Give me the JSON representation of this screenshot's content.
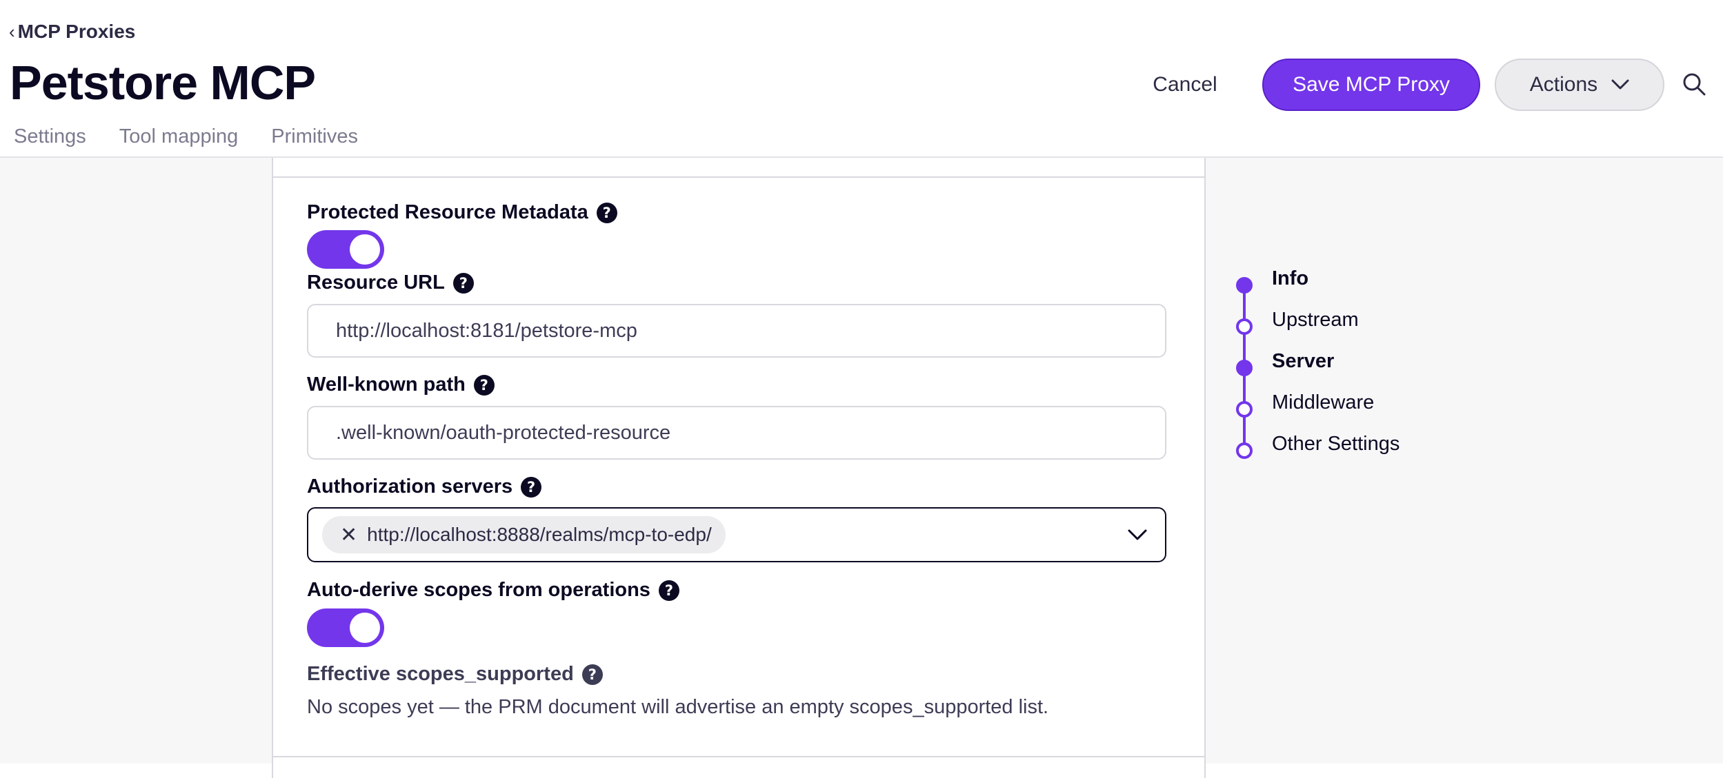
{
  "breadcrumb": {
    "chevron": "‹",
    "label": "MCP Proxies"
  },
  "page": {
    "title": "Petstore MCP"
  },
  "tabs": [
    {
      "label": "Settings"
    },
    {
      "label": "Tool mapping"
    },
    {
      "label": "Primitives"
    }
  ],
  "toolbar": {
    "cancel_label": "Cancel",
    "save_label": "Save MCP Proxy",
    "actions_label": "Actions",
    "search_icon": "search-icon"
  },
  "form": {
    "prm": {
      "label": "Protected Resource Metadata",
      "help": "?",
      "enabled": true
    },
    "resource_url": {
      "label": "Resource URL",
      "help": "?",
      "value": "http://localhost:8181/petstore-mcp"
    },
    "well_known": {
      "label": "Well-known path",
      "help": "?",
      "value": ".well-known/oauth-protected-resource"
    },
    "auth_servers": {
      "label": "Authorization servers",
      "help": "?",
      "selected": [
        "http://localhost:8888/realms/mcp-to-edp/"
      ],
      "remove_glyph": "✕"
    },
    "auto_derive": {
      "label": "Auto-derive scopes from operations",
      "help": "?",
      "enabled": true
    },
    "effective_scopes": {
      "label": "Effective scopes_supported",
      "help": "?",
      "text": "No scopes yet — the PRM document will advertise an empty scopes_supported list."
    }
  },
  "toc": {
    "items": [
      {
        "label": "Info",
        "active": true
      },
      {
        "label": "Upstream",
        "active": false
      },
      {
        "label": "Server",
        "active": true
      },
      {
        "label": "Middleware",
        "active": false
      },
      {
        "label": "Other Settings",
        "active": false
      }
    ]
  },
  "colors": {
    "accent": "#7336eb",
    "text": "#0b0a22",
    "muted": "#7b7b8f"
  }
}
